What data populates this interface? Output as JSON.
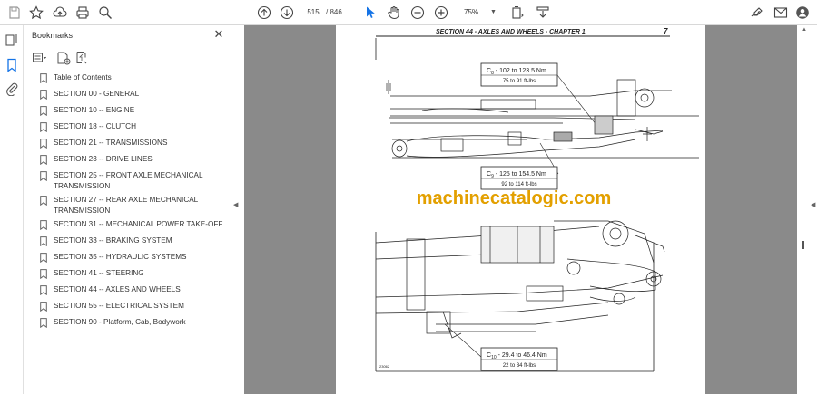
{
  "toolbar": {
    "current_page": "515",
    "total_pages": "/ 846",
    "zoom": "75%"
  },
  "bookmarks": {
    "title": "Bookmarks",
    "close_symbol": "✕",
    "items": [
      {
        "label": "Table of Contents"
      },
      {
        "label": "SECTION 00 - GENERAL"
      },
      {
        "label": "SECTION 10 -- ENGINE"
      },
      {
        "label": "SECTION 18 -- CLUTCH"
      },
      {
        "label": "SECTION 21 -- TRANSMISSIONS"
      },
      {
        "label": "SECTION 23 -- DRIVE LINES"
      },
      {
        "label": "SECTION 25 -- FRONT AXLE MECHANICAL TRANSMISSION"
      },
      {
        "label": "SECTION 27 -- REAR AXLE MECHANICAL TRANSMISSION"
      },
      {
        "label": "SECTION 31 -- MECHANICAL POWER TAKE-OFF"
      },
      {
        "label": "SECTION 33 -- BRAKING SYSTEM"
      },
      {
        "label": "SECTION 35 -- HYDRAULIC SYSTEMS"
      },
      {
        "label": "SECTION 41 -- STEERING"
      },
      {
        "label": "SECTION 44 -- AXLES AND WHEELS"
      },
      {
        "label": "SECTION 55 -- ELECTRICAL SYSTEM"
      },
      {
        "label": "SECTION 90 - Platform, Cab, Bodywork"
      }
    ]
  },
  "document": {
    "header_title": "SECTION 44 - AXLES AND WHEELS - CHAPTER 1",
    "page_number": "7",
    "watermark": "machinecatalogic.com",
    "c8_sub": "8",
    "c8_value": " - 102 to 123.5 Nm",
    "c8_lbs": "75 to 91 ft-lbs",
    "c9_sub": "9",
    "c9_value": " - 125 to 154.5 Nm",
    "c9_lbs": "92 to 114 ft-lbs",
    "c10_sub": "10",
    "c10_value": " - 29.4 to 46.4 Nm",
    "c10_lbs": "22 to 34 ft-lbs",
    "c_letter": "C",
    "figure_id": "23062"
  }
}
